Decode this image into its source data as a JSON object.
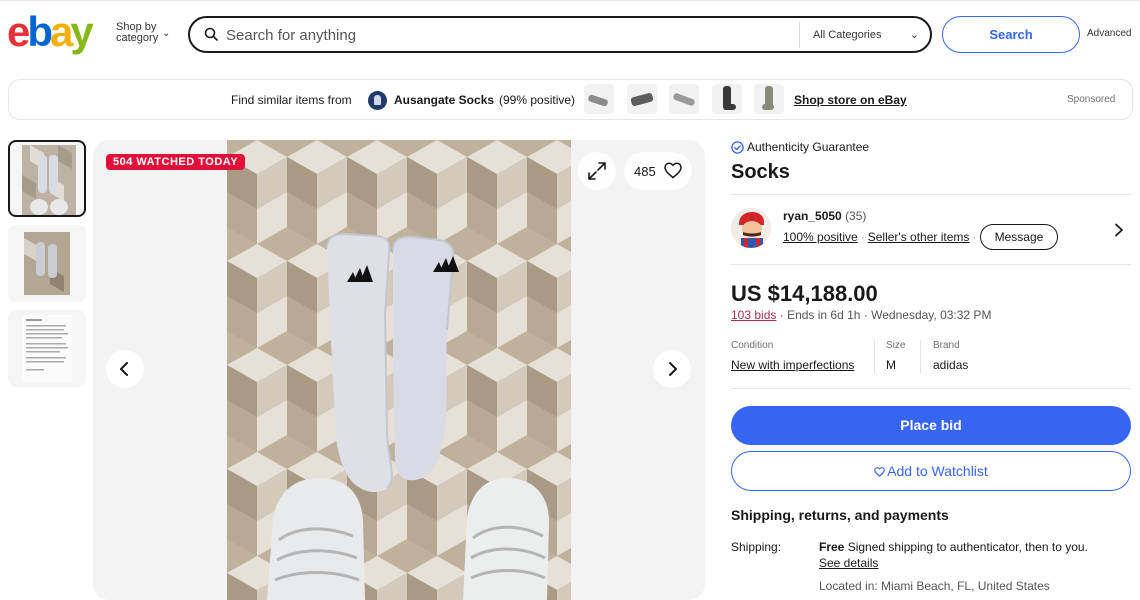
{
  "header": {
    "logo_letters": [
      "e",
      "b",
      "a",
      "y"
    ],
    "shop_by_line1": "Shop by",
    "shop_by_line2": "category",
    "search_placeholder": "Search for anything",
    "category_select": "All Categories",
    "search_button": "Search",
    "advanced_link": "Advanced"
  },
  "sponsored_bar": {
    "find_text": "Find similar items from",
    "store_name": "Ausangate Socks",
    "store_feedback": "(99% positive)",
    "shop_store_link": "Shop store on eBay",
    "sponsored_label": "Sponsored"
  },
  "gallery": {
    "watched_badge": "504 WATCHED TODAY",
    "watch_count": "485",
    "thumbnail_count": 3,
    "selected_thumbnail": 1
  },
  "item": {
    "authenticity": "Authenticity Guarantee",
    "title": "Socks",
    "seller": {
      "name": "ryan_5050",
      "score": "(35)",
      "positive": "100% positive",
      "other_items": "Seller's other items",
      "message_button": "Message"
    },
    "price": "US $14,188.00",
    "bids": "103 bids",
    "ends_in": "Ends in 6d 1h",
    "end_time": "Wednesday, 03:32 PM",
    "attributes": [
      {
        "label": "Condition",
        "value": "New with imperfections"
      },
      {
        "label": "Size",
        "value": "M"
      },
      {
        "label": "Brand",
        "value": "adidas"
      }
    ],
    "place_bid_button": "Place bid",
    "watchlist_button": "Add to Watchlist",
    "shipping": {
      "heading": "Shipping, returns, and payments",
      "label": "Shipping:",
      "free": "Free",
      "description": "Signed shipping to authenticator, then to you.",
      "see_details": "See details",
      "location": "Located in: Miami Beach, FL, United States"
    }
  },
  "colors": {
    "accent_blue": "#3665f3",
    "badge_red": "#e0103a",
    "bids_link": "#a9304b"
  }
}
